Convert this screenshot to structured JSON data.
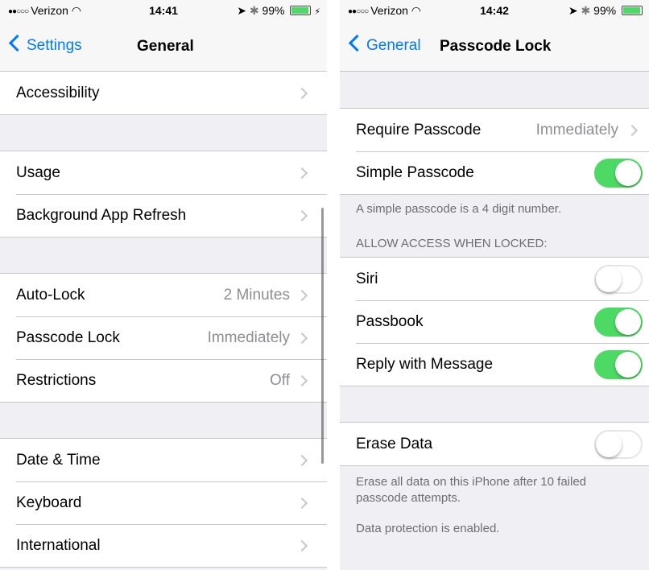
{
  "left": {
    "status": {
      "carrier": "Verizon",
      "signal_dots": "●●○○○",
      "time": "14:41",
      "battery": "99%"
    },
    "nav": {
      "back_label": "Settings",
      "title": "General"
    },
    "rows": {
      "accessibility": "Accessibility",
      "usage": "Usage",
      "background_refresh": "Background App Refresh",
      "auto_lock": {
        "label": "Auto-Lock",
        "value": "2 Minutes"
      },
      "passcode_lock": {
        "label": "Passcode Lock",
        "value": "Immediately"
      },
      "restrictions": {
        "label": "Restrictions",
        "value": "Off"
      },
      "date_time": "Date & Time",
      "keyboard": "Keyboard",
      "international": "International"
    }
  },
  "right": {
    "status": {
      "carrier": "Verizon",
      "signal_dots": "●●○○○",
      "time": "14:42",
      "battery": "99%"
    },
    "nav": {
      "back_label": "General",
      "title": "Passcode Lock"
    },
    "require_passcode": {
      "label": "Require Passcode",
      "value": "Immediately"
    },
    "simple_passcode": {
      "label": "Simple Passcode",
      "on": true
    },
    "simple_footer": "A simple passcode is a 4 digit number.",
    "allow_header": "ALLOW ACCESS WHEN LOCKED:",
    "siri": {
      "label": "Siri",
      "on": false
    },
    "passbook": {
      "label": "Passbook",
      "on": true
    },
    "reply_message": {
      "label": "Reply with Message",
      "on": true
    },
    "erase_data": {
      "label": "Erase Data",
      "on": false
    },
    "erase_footer": "Erase all data on this iPhone after 10 failed passcode attempts.",
    "protection_footer": "Data protection is enabled."
  },
  "colors": {
    "accent": "#007aff",
    "toggle_on": "#4cd964",
    "background": "#efeff4"
  },
  "icons": [
    "location-arrow-icon",
    "bluetooth-icon",
    "battery-icon",
    "charging-icon",
    "wifi-icon",
    "back-chevron-icon",
    "disclosure-chevron-icon"
  ]
}
